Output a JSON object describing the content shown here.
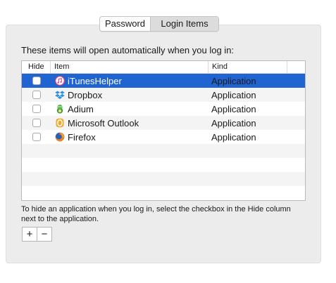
{
  "tabs": {
    "password_label": "Password",
    "login_items_label": "Login Items",
    "selected": "Login Items"
  },
  "heading": "These items will open automatically when you log in:",
  "table": {
    "columns": {
      "hide": "Hide",
      "item": "Item",
      "kind": "Kind"
    },
    "rows": [
      {
        "name": "iTunesHelper",
        "kind": "Application",
        "hide": false,
        "selected": true,
        "icon": "itunes-icon"
      },
      {
        "name": "Dropbox",
        "kind": "Application",
        "hide": false,
        "selected": false,
        "icon": "dropbox-icon"
      },
      {
        "name": "Adium",
        "kind": "Application",
        "hide": false,
        "selected": false,
        "icon": "adium-icon"
      },
      {
        "name": "Microsoft Outlook",
        "kind": "Application",
        "hide": false,
        "selected": false,
        "icon": "outlook-icon"
      },
      {
        "name": "Firefox",
        "kind": "Application",
        "hide": false,
        "selected": false,
        "icon": "firefox-icon"
      }
    ]
  },
  "footer_text": "To hide an application when you log in, select the checkbox in the Hide column next to the application.",
  "buttons": {
    "add_label": "+",
    "remove_label": "−"
  },
  "colors": {
    "selection": "#1f64d1",
    "panel_background": "#ececec"
  }
}
